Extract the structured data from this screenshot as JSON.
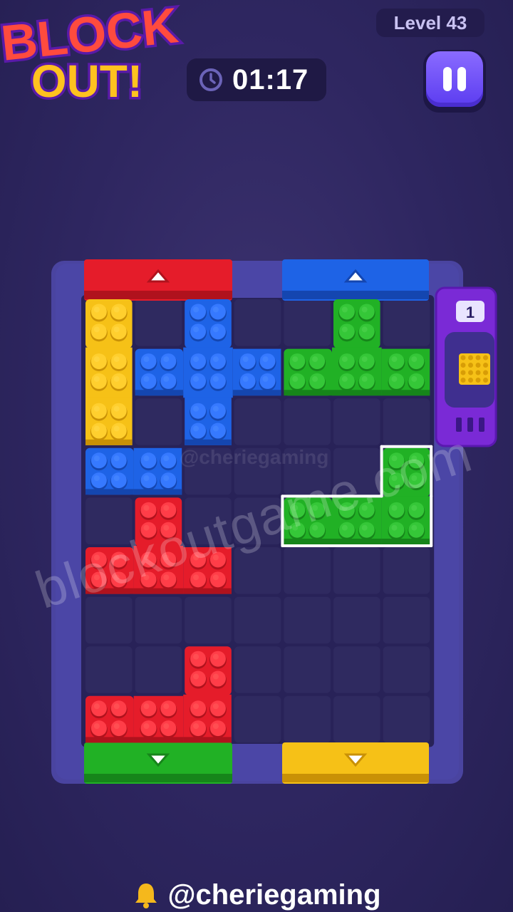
{
  "logo": {
    "line1": "BLOCK",
    "line2": "OUT!"
  },
  "level_label": "Level 43",
  "timer": {
    "time": "01:17"
  },
  "icons": {
    "clock": "clock-icon",
    "pause": "pause-icon",
    "bell": "bell-icon",
    "arrow_up": "arrow-up-icon",
    "arrow_down": "arrow-down-icon"
  },
  "counter_value": "1",
  "watermark": "blockoutgame.com",
  "watermark_small": "@cheriegaming",
  "footer_handle": "@cheriegaming",
  "colors": {
    "red": "#e51c2a",
    "blue": "#1e63e6",
    "green": "#21b125",
    "yellow": "#f6c117",
    "purple": "#9b3dea",
    "board": "#3c3a8c",
    "cell": "#2f2a60"
  },
  "board": {
    "rows": 9,
    "cols": 7,
    "exits": [
      {
        "side": "top",
        "color": "red",
        "direction": "up"
      },
      {
        "side": "top",
        "color": "blue",
        "direction": "up"
      },
      {
        "side": "bottom",
        "color": "green",
        "direction": "down"
      },
      {
        "side": "bottom",
        "color": "yellow",
        "direction": "down"
      }
    ],
    "pieces": [
      {
        "color": "yellow",
        "cells": [
          [
            0,
            0
          ],
          [
            1,
            0
          ],
          [
            2,
            0
          ]
        ]
      },
      {
        "color": "blue",
        "cells": [
          [
            0,
            2
          ],
          [
            1,
            1
          ],
          [
            1,
            2
          ],
          [
            1,
            3
          ],
          [
            2,
            2
          ]
        ]
      },
      {
        "color": "green",
        "cells": [
          [
            0,
            5
          ],
          [
            1,
            4
          ],
          [
            1,
            5
          ],
          [
            1,
            6
          ]
        ]
      },
      {
        "color": "blue",
        "cells": [
          [
            3,
            0
          ],
          [
            3,
            1
          ]
        ]
      },
      {
        "color": "green",
        "cells": [
          [
            3,
            6
          ],
          [
            4,
            4
          ],
          [
            4,
            5
          ],
          [
            4,
            6
          ]
        ],
        "selected": true
      },
      {
        "color": "red",
        "cells": [
          [
            4,
            1
          ],
          [
            5,
            0
          ],
          [
            5,
            1
          ],
          [
            5,
            2
          ]
        ]
      },
      {
        "color": "red",
        "cells": [
          [
            7,
            2
          ],
          [
            8,
            0
          ],
          [
            8,
            1
          ],
          [
            8,
            2
          ]
        ]
      }
    ]
  }
}
